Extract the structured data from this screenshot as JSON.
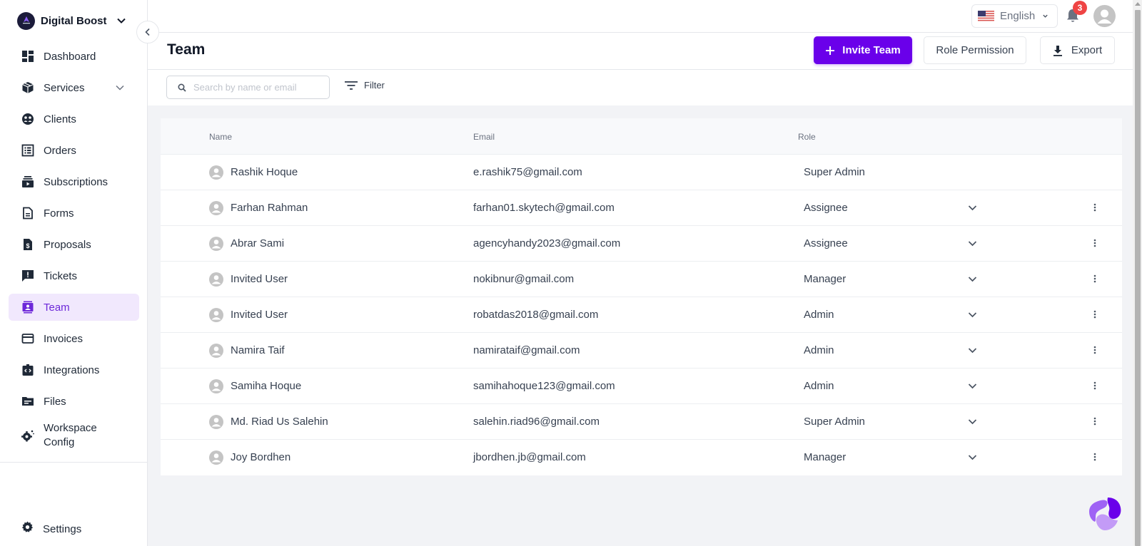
{
  "workspace": {
    "name": "Digital Boost"
  },
  "sidebar": {
    "items": [
      {
        "label": "Dashboard",
        "icon": "dashboard-icon"
      },
      {
        "label": "Services",
        "icon": "box-icon",
        "has_submenu": true
      },
      {
        "label": "Clients",
        "icon": "clients-icon"
      },
      {
        "label": "Orders",
        "icon": "orders-icon"
      },
      {
        "label": "Subscriptions",
        "icon": "subscriptions-icon"
      },
      {
        "label": "Forms",
        "icon": "forms-icon"
      },
      {
        "label": "Proposals",
        "icon": "proposals-icon"
      },
      {
        "label": "Tickets",
        "icon": "tickets-icon"
      },
      {
        "label": "Team",
        "icon": "team-icon",
        "active": true
      },
      {
        "label": "Invoices",
        "icon": "invoices-icon"
      },
      {
        "label": "Integrations",
        "icon": "integrations-icon"
      },
      {
        "label": "Files",
        "icon": "files-icon"
      },
      {
        "label": "Workspace Config",
        "icon": "workspace-config-icon"
      }
    ],
    "settings_label": "Settings"
  },
  "topbar": {
    "language": "English",
    "notification_count": "3"
  },
  "header": {
    "title": "Team",
    "invite_label": "Invite Team",
    "role_permission_label": "Role Permission",
    "export_label": "Export"
  },
  "toolbar": {
    "search_placeholder": "Search by name or email",
    "search_value": "",
    "filter_label": "Filter"
  },
  "table": {
    "columns": [
      "Name",
      "Email",
      "Role"
    ],
    "rows": [
      {
        "name": "Rashik Hoque",
        "email": "e.rashik75@gmail.com",
        "role": "Super Admin",
        "editable": false
      },
      {
        "name": "Farhan Rahman",
        "email": "farhan01.skytech@gmail.com",
        "role": "Assignee",
        "editable": true
      },
      {
        "name": "Abrar Sami",
        "email": "agencyhandy2023@gmail.com",
        "role": "Assignee",
        "editable": true
      },
      {
        "name": "Invited User",
        "email": "nokibnur@gmail.com",
        "role": "Manager",
        "editable": true
      },
      {
        "name": "Invited User",
        "email": "robatdas2018@gmail.com",
        "role": "Admin",
        "editable": true
      },
      {
        "name": "Namira Taif",
        "email": "namirataif@gmail.com",
        "role": "Admin",
        "editable": true
      },
      {
        "name": "Samiha Hoque",
        "email": "samihahoque123@gmail.com",
        "role": "Admin",
        "editable": true
      },
      {
        "name": "Md. Riad Us Salehin",
        "email": "salehin.riad96@gmail.com",
        "role": "Super Admin",
        "editable": true
      },
      {
        "name": "Joy Bordhen",
        "email": "jbordhen.jb@gmail.com",
        "role": "Manager",
        "editable": true
      }
    ]
  },
  "colors": {
    "accent": "#6a00ea",
    "active_bg": "#f1e8fd",
    "badge": "#ef4444"
  }
}
